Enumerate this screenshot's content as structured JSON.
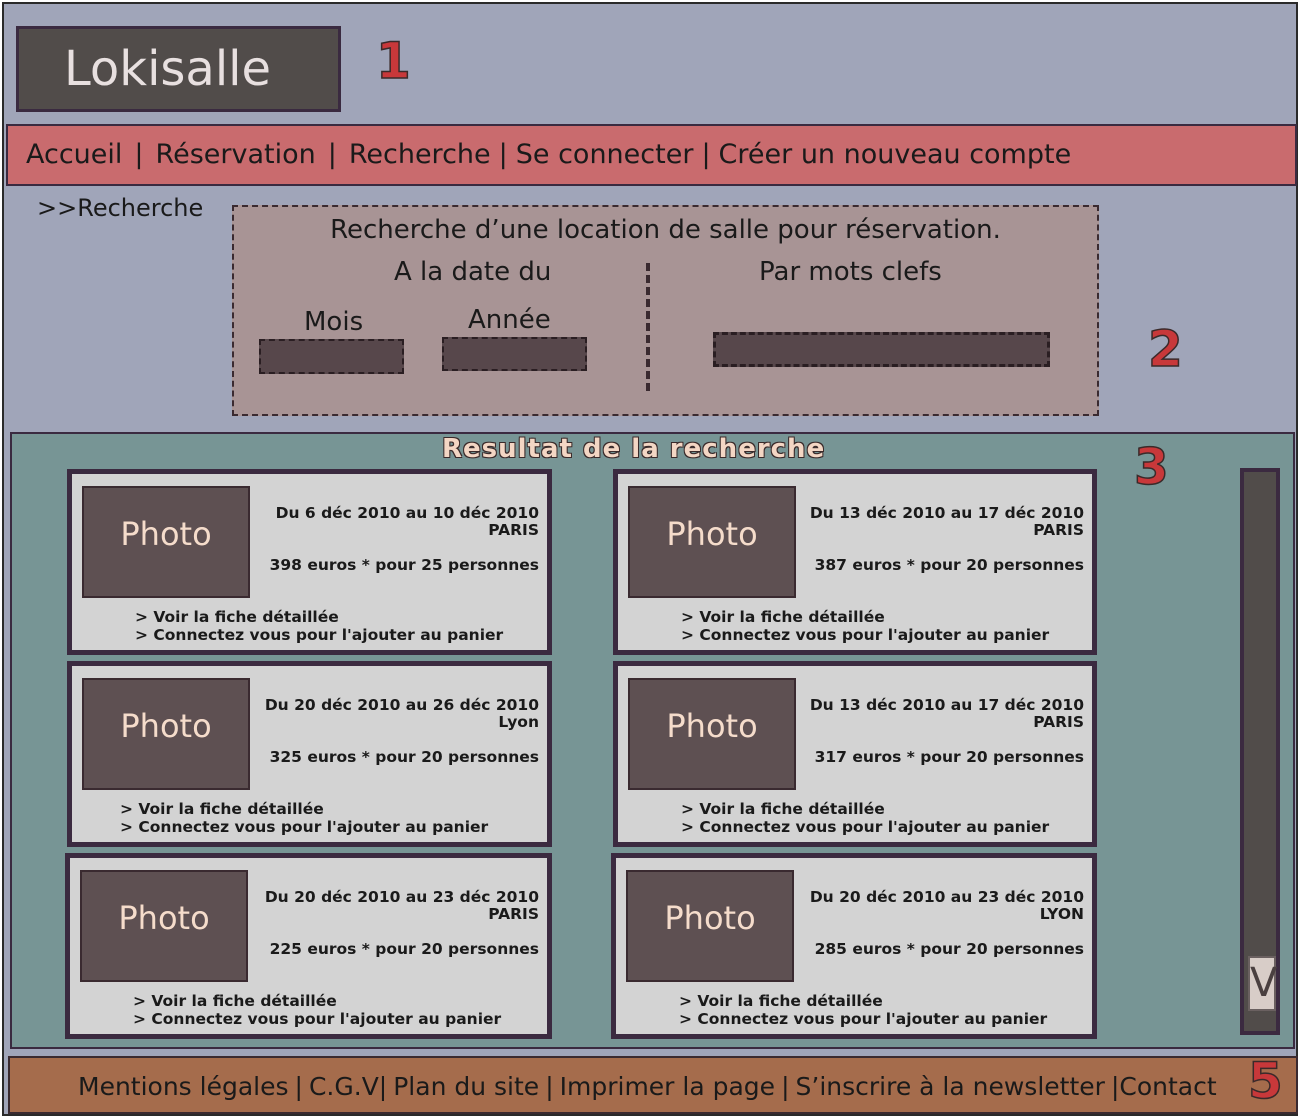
{
  "logo": "Lokisalle",
  "annotations": [
    "1",
    "2",
    "3",
    "5"
  ],
  "nav": [
    "Accueil",
    "Réservation",
    "Recherche",
    "Se connecter",
    "Créer un nouveau compte"
  ],
  "nav_separator": "|",
  "breadcrumb": ">>Recherche",
  "search": {
    "title": "Recherche d’une location de salle pour réservation.",
    "date_label": "A la date du",
    "month_label": "Mois",
    "year_label": "Année",
    "keywords_label": "Par mots clefs"
  },
  "results": {
    "title": "Resultat de la recherche",
    "photo_label": "Photo",
    "link_detail": "> Voir la fiche détaillée",
    "link_cart": "> Connectez vous pour l'ajouter au panier",
    "cards": [
      {
        "dates": "Du 6 déc 2010 au 10 déc 2010",
        "city": "PARIS",
        "price": "398 euros * pour 25 personnes"
      },
      {
        "dates": "Du 13 déc 2010 au 17 déc 2010",
        "city": "PARIS",
        "price": "387 euros * pour 20 personnes"
      },
      {
        "dates": "Du 20 déc 2010 au 26 déc 2010",
        "city": "Lyon",
        "price": "325 euros * pour 20 personnes"
      },
      {
        "dates": "Du 13 déc 2010 au 17 déc 2010",
        "city": "PARIS",
        "price": "317 euros * pour 20 personnes"
      },
      {
        "dates": "Du 20 déc 2010 au 23 déc 2010",
        "city": "PARIS",
        "price": "225 euros * pour 20 personnes"
      },
      {
        "dates": "Du 20 déc 2010 au 23 déc 2010",
        "city": "LYON",
        "price": "285 euros * pour 20 personnes"
      }
    ]
  },
  "scroll_label": "V",
  "footer": [
    "Mentions légales",
    "C.G.V",
    "Plan du site",
    "Imprimer la page",
    "S’inscrire à la newsletter",
    "Contact"
  ],
  "footer_separator": "|",
  "colors": {
    "page_bg": "#a0a5b9",
    "nav_bg": "#c96b6e",
    "search_bg": "#a89495",
    "results_bg": "#779595",
    "card_bg": "#d3d3d3",
    "footer_bg": "#a56c4c",
    "annotation": "#c8383a"
  }
}
